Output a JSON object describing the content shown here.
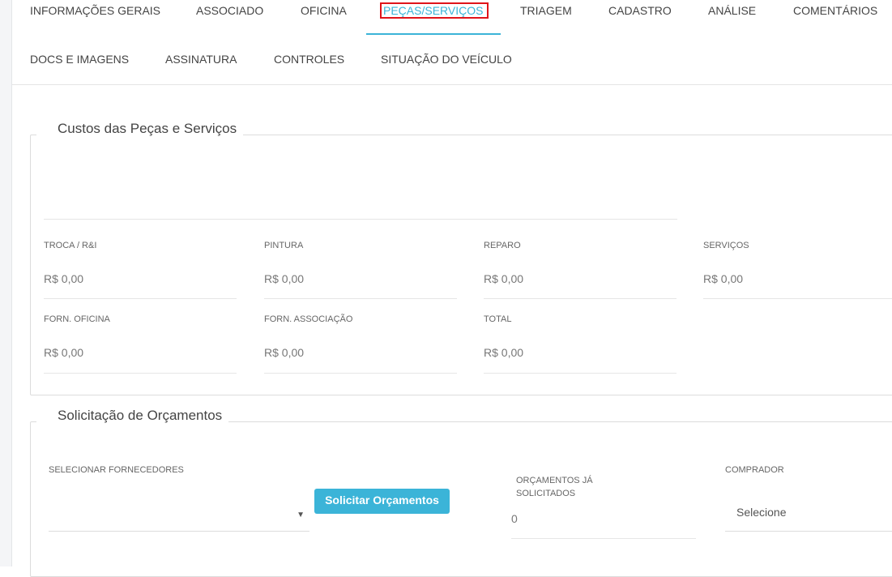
{
  "tabs": [
    {
      "label": "INFORMAÇÕES GERAIS"
    },
    {
      "label": "ASSOCIADO"
    },
    {
      "label": "OFICINA"
    },
    {
      "label": "PEÇAS/SERVIÇOS",
      "active": true
    },
    {
      "label": "TRIAGEM"
    },
    {
      "label": "CADASTRO"
    },
    {
      "label": "ANÁLISE"
    },
    {
      "label": "COMENTÁRIOS"
    },
    {
      "label": "DOCS E IMAGENS"
    },
    {
      "label": "ASSINATURA"
    },
    {
      "label": "CONTROLES"
    },
    {
      "label": "SITUAÇÃO DO VEÍCULO"
    }
  ],
  "costs": {
    "title": "Custos das Peças e Serviços",
    "fields": [
      {
        "label": "TROCA / R&I",
        "value": "R$ 0,00"
      },
      {
        "label": "PINTURA",
        "value": "R$ 0,00"
      },
      {
        "label": "REPARO",
        "value": "R$ 0,00"
      },
      {
        "label": "SERVIÇOS",
        "value": "R$ 0,00"
      },
      {
        "label": "FORN. OFICINA",
        "value": "R$ 0,00"
      },
      {
        "label": "FORN. ASSOCIAÇÃO",
        "value": "R$ 0,00"
      },
      {
        "label": "TOTAL",
        "value": "R$ 0,00"
      }
    ]
  },
  "quotes": {
    "title": "Solicitação de Orçamentos",
    "suppliers_label": "SELECIONAR FORNECEDORES",
    "request_button": "Solicitar Orçamentos",
    "requested_label_line1": "ORÇAMENTOS JÁ",
    "requested_label_line2": "SOLICITADOS",
    "requested_value": "0",
    "buyer_label": "COMPRADOR",
    "buyer_value": "Selecione"
  },
  "colors": {
    "accent": "#3bb4d8",
    "highlight": "#e0141a"
  }
}
